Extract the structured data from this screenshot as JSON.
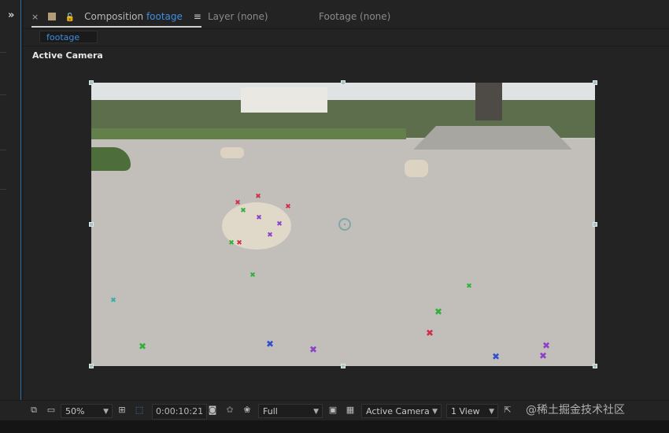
{
  "left_panel": {
    "collapse_label": "»"
  },
  "tabs": {
    "composition": {
      "close": "×",
      "prefix": "Composition",
      "name": "footage",
      "menu": "≡"
    },
    "layer": {
      "label": "Layer (none)"
    },
    "footage": {
      "label": "Footage (none)"
    }
  },
  "comp_chip": "footage",
  "view_label": "Active Camera",
  "toolbar": {
    "zoom": "50%",
    "timecode": "0:00:10:21",
    "resolution": "Full",
    "camera": "Active Camera",
    "views": "1 View"
  },
  "watermark": "@稀土掘金技术社区",
  "colors": {
    "accent": "#3d8fe0",
    "track_green": "#2fb03a",
    "track_red": "#d0304a",
    "track_purple": "#8b40c8",
    "track_blue": "#3050d0",
    "track_cyan": "#2ab0b0"
  }
}
